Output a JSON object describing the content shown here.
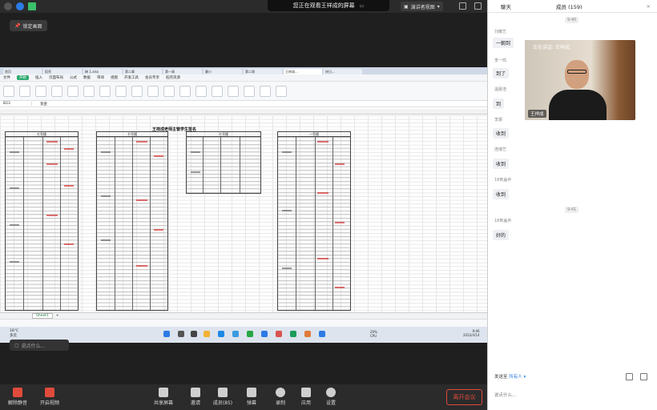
{
  "banner": {
    "text": "您正在观看王祥成的屏幕"
  },
  "presenter_view_label": "演讲者视图",
  "lock_screen_label": "锁定画面",
  "spreadsheet": {
    "tabs": [
      "首页",
      "稻壳",
      "稀 1.xlsx",
      "第二章",
      "第一周",
      "最小",
      "第二周",
      "王祥成...",
      "终日..."
    ],
    "menu": [
      "文件",
      "开始",
      "插入",
      "页面布局",
      "公式",
      "数据",
      "审阅",
      "视图",
      "开发工具",
      "会员专享",
      "稻壳资源"
    ],
    "active_menu": "开始",
    "cell_ref": "B23",
    "formula_value": "宽金",
    "title": "王祥成老师主管学生签名",
    "block_headers": [
      "七号楼",
      "七号楼",
      "七号楼",
      "一号楼"
    ],
    "sheet_name": "Sheet1"
  },
  "taskbar": {
    "weather_temp": "18°C",
    "weather_desc": "多云",
    "sys_cpu": "29%",
    "sys_cpu_label": "CPU",
    "time": "9:46",
    "date": "2022/4/14"
  },
  "left_chat_input": {
    "placeholder": "说点什么..."
  },
  "toolbar": {
    "mute": "解除静音",
    "video": "开启视频",
    "share": "共享屏幕",
    "invite": "邀请",
    "members": "成员(85)",
    "reactions": "弹幕",
    "record": "录制",
    "apps": "应用",
    "settings": "设置",
    "leave": "离开会议"
  },
  "right_panel": {
    "tab_chat": "聊天",
    "tab_members": "成员 (159)",
    "close_glyph": "×",
    "speaking": "正在讲话: 王祥成;",
    "video_name": "王祥成",
    "messages": [
      {
        "time": "9:40",
        "name": "刘耀艺",
        "text": "一朝到"
      },
      {
        "name": "李一鸣",
        "text": "到了"
      },
      {
        "name": "温晨浩",
        "text": "到"
      },
      {
        "name": "李振",
        "text": "收到"
      },
      {
        "name": "连瑞艺",
        "text": "收到"
      },
      {
        "name": "18到盖乔",
        "text": "收到"
      },
      {
        "time": "9:41",
        "name": "18到盖乔",
        "text": "好的"
      }
    ],
    "send_to_label": "发送至",
    "send_to_target": "所有人 ▾",
    "input_placeholder": "说点什么..."
  },
  "colors": {
    "leave_red": "#e04b3c",
    "accent_green": "#2aa86c",
    "link_blue": "#2c7be5"
  }
}
